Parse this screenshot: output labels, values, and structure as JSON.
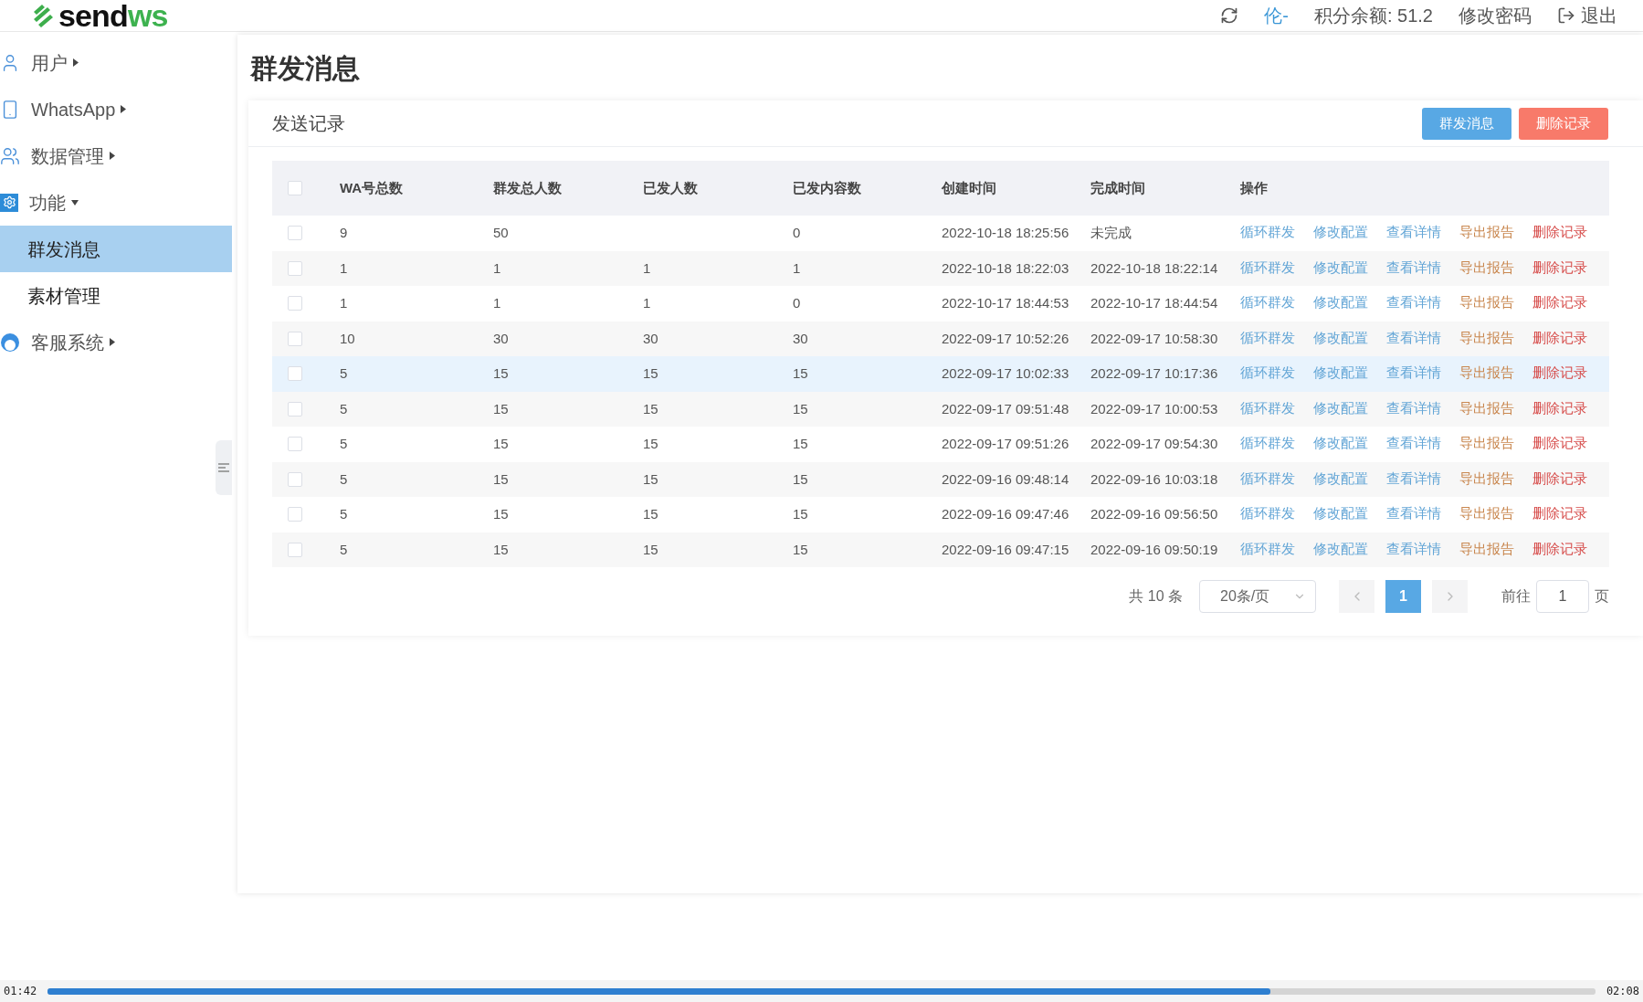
{
  "header": {
    "logo": {
      "part1": "send",
      "part2": "ws"
    },
    "user": "伦-",
    "balance": "积分余额: 51.2",
    "change_password": "修改密码",
    "logout": "退出"
  },
  "sidebar": {
    "items": [
      {
        "label": "用户",
        "expanded": false
      },
      {
        "label": "WhatsApp",
        "expanded": false
      },
      {
        "label": "数据管理",
        "expanded": false
      },
      {
        "label": "功能",
        "expanded": true,
        "children": [
          {
            "label": "群发消息",
            "selected": true
          },
          {
            "label": "素材管理",
            "selected": false
          }
        ]
      },
      {
        "label": "客服系统",
        "expanded": false
      }
    ]
  },
  "page": {
    "title": "群发消息"
  },
  "card": {
    "title": "发送记录",
    "buttons": [
      {
        "label": "群发消息",
        "kind": "primary"
      },
      {
        "label": "删除记录",
        "kind": "danger"
      }
    ]
  },
  "table": {
    "select_all": {
      "checked": false
    },
    "columns": [
      "WA号总数",
      "群发总人数",
      "已发人数",
      "已发内容数",
      "创建时间",
      "完成时间",
      "操作"
    ],
    "rows": [
      {
        "checked": false,
        "highlighted": false,
        "cells": [
          "9",
          "50",
          "",
          "0",
          "2022-10-18 18:25:56",
          "未完成"
        ],
        "actions": [
          {
            "label": "循环群发",
            "kind": "primary"
          },
          {
            "label": "修改配置",
            "kind": "primary"
          },
          {
            "label": "查看详情",
            "kind": "primary"
          },
          {
            "label": "导出报告",
            "kind": "warning"
          },
          {
            "label": "删除记录",
            "kind": "danger"
          }
        ]
      },
      {
        "checked": false,
        "highlighted": false,
        "cells": [
          "1",
          "1",
          "1",
          "1",
          "2022-10-18 18:22:03",
          "2022-10-18 18:22:14"
        ],
        "actions": [
          {
            "label": "循环群发",
            "kind": "primary"
          },
          {
            "label": "修改配置",
            "kind": "primary"
          },
          {
            "label": "查看详情",
            "kind": "primary"
          },
          {
            "label": "导出报告",
            "kind": "warning"
          },
          {
            "label": "删除记录",
            "kind": "danger"
          }
        ]
      },
      {
        "checked": false,
        "highlighted": false,
        "cells": [
          "1",
          "1",
          "1",
          "0",
          "2022-10-17 18:44:53",
          "2022-10-17 18:44:54"
        ],
        "actions": [
          {
            "label": "循环群发",
            "kind": "primary"
          },
          {
            "label": "修改配置",
            "kind": "primary"
          },
          {
            "label": "查看详情",
            "kind": "primary"
          },
          {
            "label": "导出报告",
            "kind": "warning"
          },
          {
            "label": "删除记录",
            "kind": "danger"
          }
        ]
      },
      {
        "checked": false,
        "highlighted": false,
        "cells": [
          "10",
          "30",
          "30",
          "30",
          "2022-09-17 10:52:26",
          "2022-09-17 10:58:30"
        ],
        "actions": [
          {
            "label": "循环群发",
            "kind": "primary"
          },
          {
            "label": "修改配置",
            "kind": "primary"
          },
          {
            "label": "查看详情",
            "kind": "primary"
          },
          {
            "label": "导出报告",
            "kind": "warning"
          },
          {
            "label": "删除记录",
            "kind": "danger"
          }
        ]
      },
      {
        "checked": false,
        "highlighted": true,
        "cells": [
          "5",
          "15",
          "15",
          "15",
          "2022-09-17 10:02:33",
          "2022-09-17 10:17:36"
        ],
        "actions": [
          {
            "label": "循环群发",
            "kind": "primary"
          },
          {
            "label": "修改配置",
            "kind": "primary"
          },
          {
            "label": "查看详情",
            "kind": "primary"
          },
          {
            "label": "导出报告",
            "kind": "warning"
          },
          {
            "label": "删除记录",
            "kind": "danger"
          }
        ]
      },
      {
        "checked": false,
        "highlighted": false,
        "cells": [
          "5",
          "15",
          "15",
          "15",
          "2022-09-17 09:51:48",
          "2022-09-17 10:00:53"
        ],
        "actions": [
          {
            "label": "循环群发",
            "kind": "primary"
          },
          {
            "label": "修改配置",
            "kind": "primary"
          },
          {
            "label": "查看详情",
            "kind": "primary"
          },
          {
            "label": "导出报告",
            "kind": "warning"
          },
          {
            "label": "删除记录",
            "kind": "danger"
          }
        ]
      },
      {
        "checked": false,
        "highlighted": false,
        "cells": [
          "5",
          "15",
          "15",
          "15",
          "2022-09-17 09:51:26",
          "2022-09-17 09:54:30"
        ],
        "actions": [
          {
            "label": "循环群发",
            "kind": "primary"
          },
          {
            "label": "修改配置",
            "kind": "primary"
          },
          {
            "label": "查看详情",
            "kind": "primary"
          },
          {
            "label": "导出报告",
            "kind": "warning"
          },
          {
            "label": "删除记录",
            "kind": "danger"
          }
        ]
      },
      {
        "checked": false,
        "highlighted": false,
        "cells": [
          "5",
          "15",
          "15",
          "15",
          "2022-09-16 09:48:14",
          "2022-09-16 10:03:18"
        ],
        "actions": [
          {
            "label": "循环群发",
            "kind": "primary"
          },
          {
            "label": "修改配置",
            "kind": "primary"
          },
          {
            "label": "查看详情",
            "kind": "primary"
          },
          {
            "label": "导出报告",
            "kind": "warning"
          },
          {
            "label": "删除记录",
            "kind": "danger"
          }
        ]
      },
      {
        "checked": false,
        "highlighted": false,
        "cells": [
          "5",
          "15",
          "15",
          "15",
          "2022-09-16 09:47:46",
          "2022-09-16 09:56:50"
        ],
        "actions": [
          {
            "label": "循环群发",
            "kind": "primary"
          },
          {
            "label": "修改配置",
            "kind": "primary"
          },
          {
            "label": "查看详情",
            "kind": "primary"
          },
          {
            "label": "导出报告",
            "kind": "warning"
          },
          {
            "label": "删除记录",
            "kind": "danger"
          }
        ]
      },
      {
        "checked": false,
        "highlighted": false,
        "cells": [
          "5",
          "15",
          "15",
          "15",
          "2022-09-16 09:47:15",
          "2022-09-16 09:50:19"
        ],
        "actions": [
          {
            "label": "循环群发",
            "kind": "primary"
          },
          {
            "label": "修改配置",
            "kind": "primary"
          },
          {
            "label": "查看详情",
            "kind": "primary"
          },
          {
            "label": "导出报告",
            "kind": "warning"
          },
          {
            "label": "删除记录",
            "kind": "danger"
          }
        ]
      }
    ]
  },
  "pagination": {
    "total": "共 10 条",
    "page_size": "20条/页",
    "pages": [
      {
        "label": "1",
        "selected": true
      }
    ],
    "goto_label": "前往",
    "goto_value": "1",
    "goto_suffix": "页"
  },
  "video_player": {
    "elapsed": "01:42",
    "duration": "02:08",
    "level": 0.79
  }
}
